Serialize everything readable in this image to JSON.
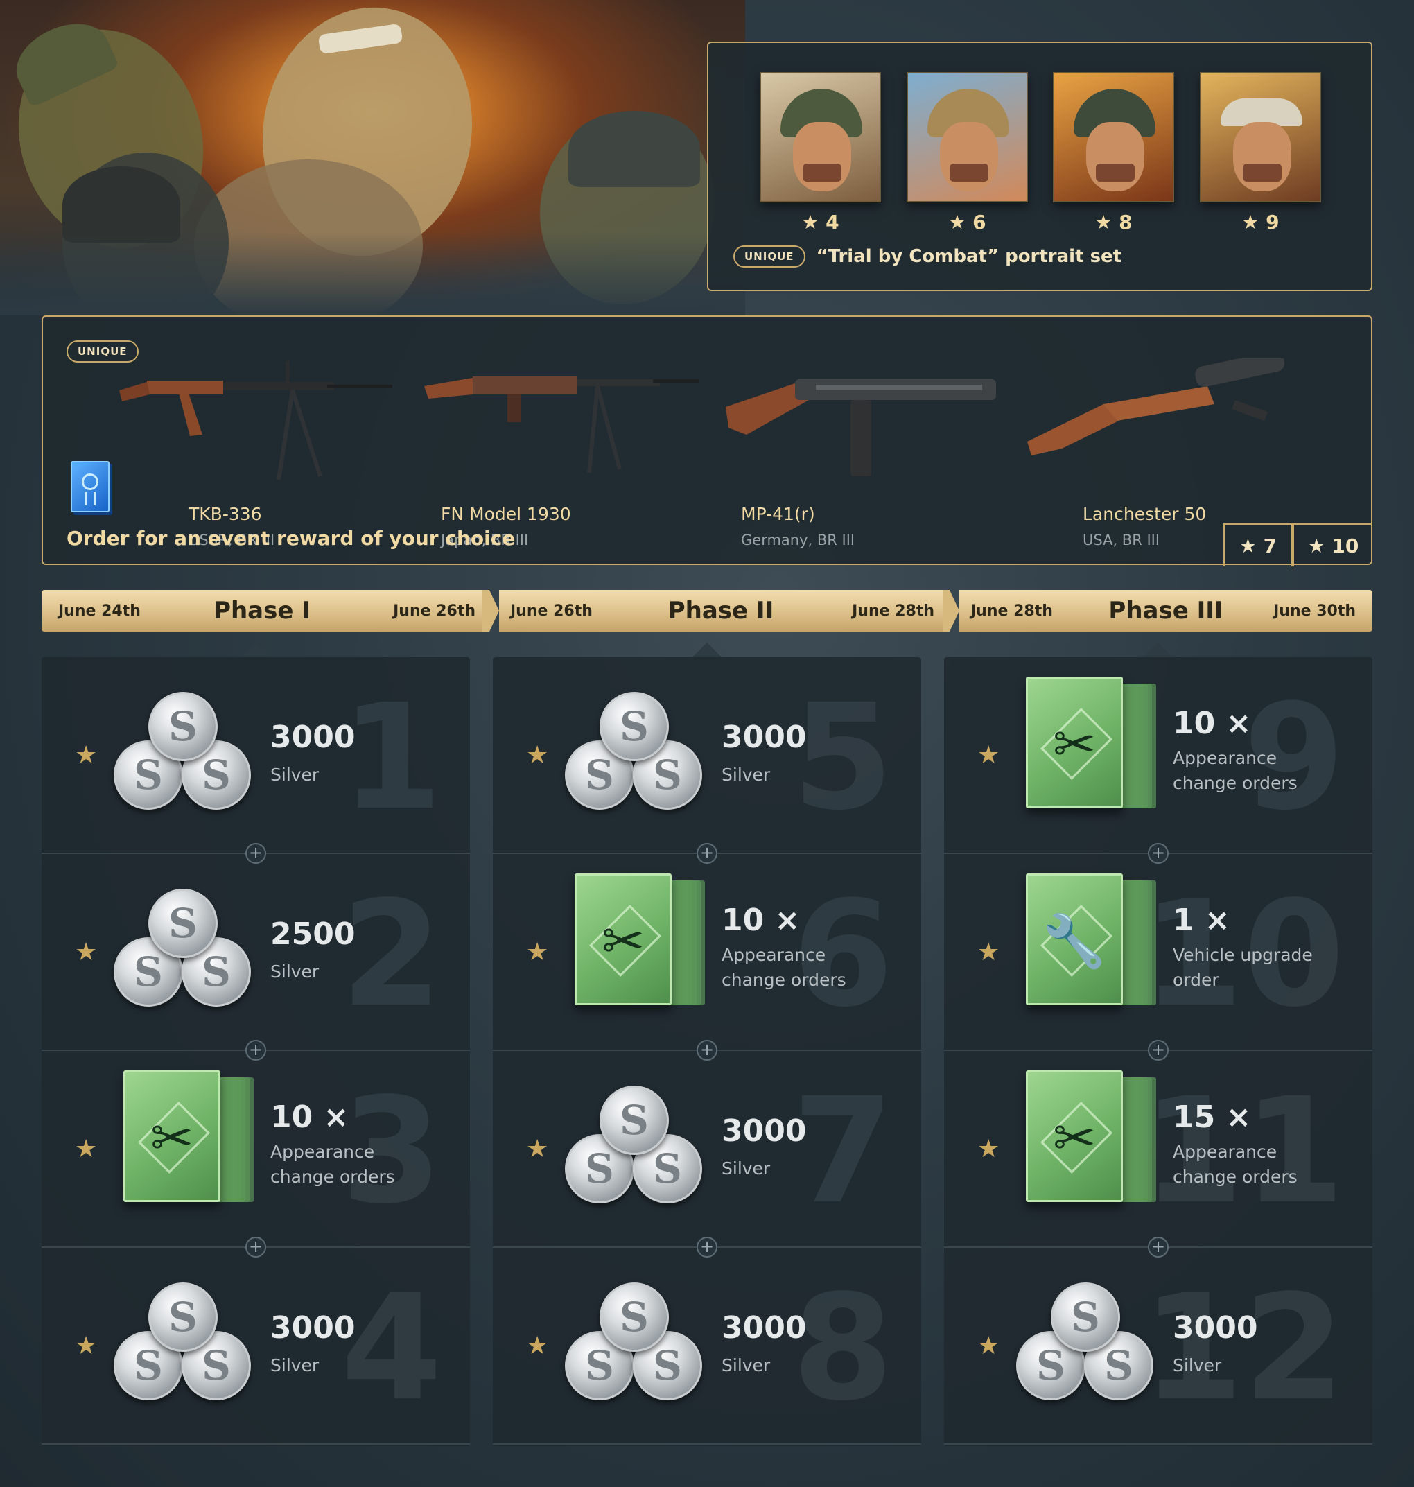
{
  "portrait_set": {
    "badge": "UNIQUE",
    "title": "“Trial by Combat” portrait set",
    "portraits": [
      {
        "stars": "★ 4"
      },
      {
        "stars": "★ 6"
      },
      {
        "stars": "★ 8"
      },
      {
        "stars": "★ 9"
      }
    ]
  },
  "weapons_panel": {
    "badge": "UNIQUE",
    "order_text": "Order for an event reward of your choice",
    "weapons": [
      {
        "name": "TKB-336",
        "sub": "USSR, BR III"
      },
      {
        "name": "FN Model 1930",
        "sub": "Japan, BR III"
      },
      {
        "name": "MP-41(r)",
        "sub": "Germany, BR III"
      },
      {
        "name": "Lanchester 50",
        "sub": "USA, BR III"
      }
    ],
    "star_costs": [
      "★ 7",
      "★ 10"
    ]
  },
  "phases": [
    {
      "start": "June 24th",
      "name": "Phase I",
      "end": "June 26th"
    },
    {
      "start": "June 26th",
      "name": "Phase II",
      "end": "June 28th"
    },
    {
      "start": "June 28th",
      "name": "Phase III",
      "end": "June 30th"
    }
  ],
  "rewards": [
    [
      {
        "num": "1",
        "icon": "silver-coins-icon",
        "amount": "3000",
        "label": "Silver"
      },
      {
        "num": "2",
        "icon": "silver-coins-icon",
        "amount": "2500",
        "label": "Silver"
      },
      {
        "num": "3",
        "icon": "appearance-order-icon",
        "amount": "10 ×",
        "label": "Appearance change orders"
      },
      {
        "num": "4",
        "icon": "silver-coins-icon",
        "amount": "3000",
        "label": "Silver"
      }
    ],
    [
      {
        "num": "5",
        "icon": "silver-coins-icon",
        "amount": "3000",
        "label": "Silver"
      },
      {
        "num": "6",
        "icon": "appearance-order-icon",
        "amount": "10 ×",
        "label": "Appearance change orders"
      },
      {
        "num": "7",
        "icon": "silver-coins-icon",
        "amount": "3000",
        "label": "Silver"
      },
      {
        "num": "8",
        "icon": "silver-coins-icon",
        "amount": "3000",
        "label": "Silver"
      }
    ],
    [
      {
        "num": "9",
        "icon": "appearance-order-icon",
        "amount": "10 ×",
        "label": "Appearance change orders"
      },
      {
        "num": "10",
        "icon": "vehicle-upgrade-order-icon",
        "amount": "1 ×",
        "label": "Vehicle upgrade order"
      },
      {
        "num": "11",
        "icon": "appearance-order-icon",
        "amount": "15 ×",
        "label": "Appearance change orders"
      },
      {
        "num": "12",
        "icon": "silver-coins-icon",
        "amount": "3000",
        "label": "Silver"
      }
    ]
  ],
  "icons": {
    "star": "★",
    "plus": "+",
    "coin_letter": "S",
    "scissors": "✂",
    "wrench": "🔧"
  },
  "colors": {
    "gold_border": "#c9a969",
    "gold_text": "#f0d9a3",
    "star": "#c9a75f",
    "background": "#2c3a43"
  }
}
